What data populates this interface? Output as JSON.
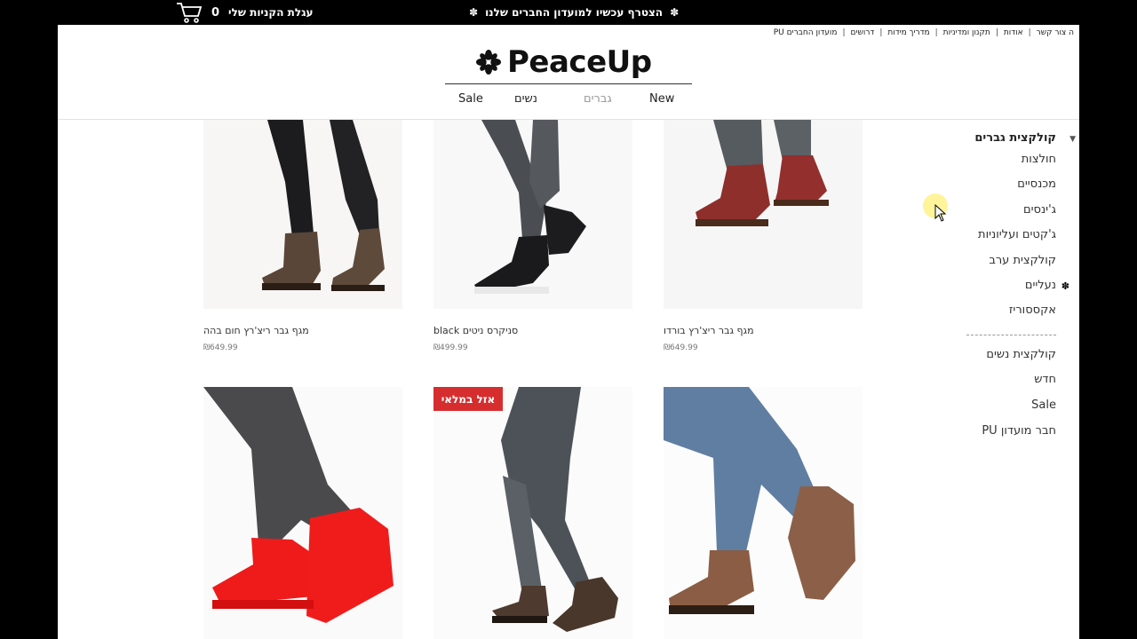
{
  "topbar": {
    "cart_count": "0",
    "cart_label": "עגלת הקניות שלי",
    "promo_text": "הצטרף עכשיו למועדון החברים שלנו"
  },
  "toplinks": [
    "ה צור קשר",
    "אודות",
    "תקנון ומדיניות",
    "מדריך מידות",
    "דרושים",
    "מועדון החברים PU"
  ],
  "logo": {
    "text": "PeaceUp"
  },
  "mainnav": {
    "new": "New",
    "men": "גברים",
    "women": "נשים",
    "sale": "Sale"
  },
  "sidebar": {
    "heading": "קולקצית גברים",
    "items": [
      "חולצות",
      "מכנסיים",
      "ג'ינסים",
      "ג'קטים ועליוניות",
      "קולקצית ערב",
      "נעליים",
      "אקססוריז"
    ],
    "items2": [
      "קולקצית נשים",
      "חדש",
      "Sale",
      "חבר מועדון PU"
    ]
  },
  "products": [
    {
      "name": "מגף גבר ריצ'רץ חום בהה",
      "price": "₪649.99"
    },
    {
      "name": "סניקרס ניטים black",
      "price": "₪499.99"
    },
    {
      "name": "מגף גבר ריצ'רץ בורדו",
      "price": "₪649.99"
    },
    {
      "name": "",
      "price": ""
    },
    {
      "name": "",
      "price": "",
      "badge": "אזל במלאי"
    },
    {
      "name": "",
      "price": ""
    }
  ],
  "colors": {
    "badge": "#d62e2e",
    "cursor_highlight": "#fff078"
  }
}
